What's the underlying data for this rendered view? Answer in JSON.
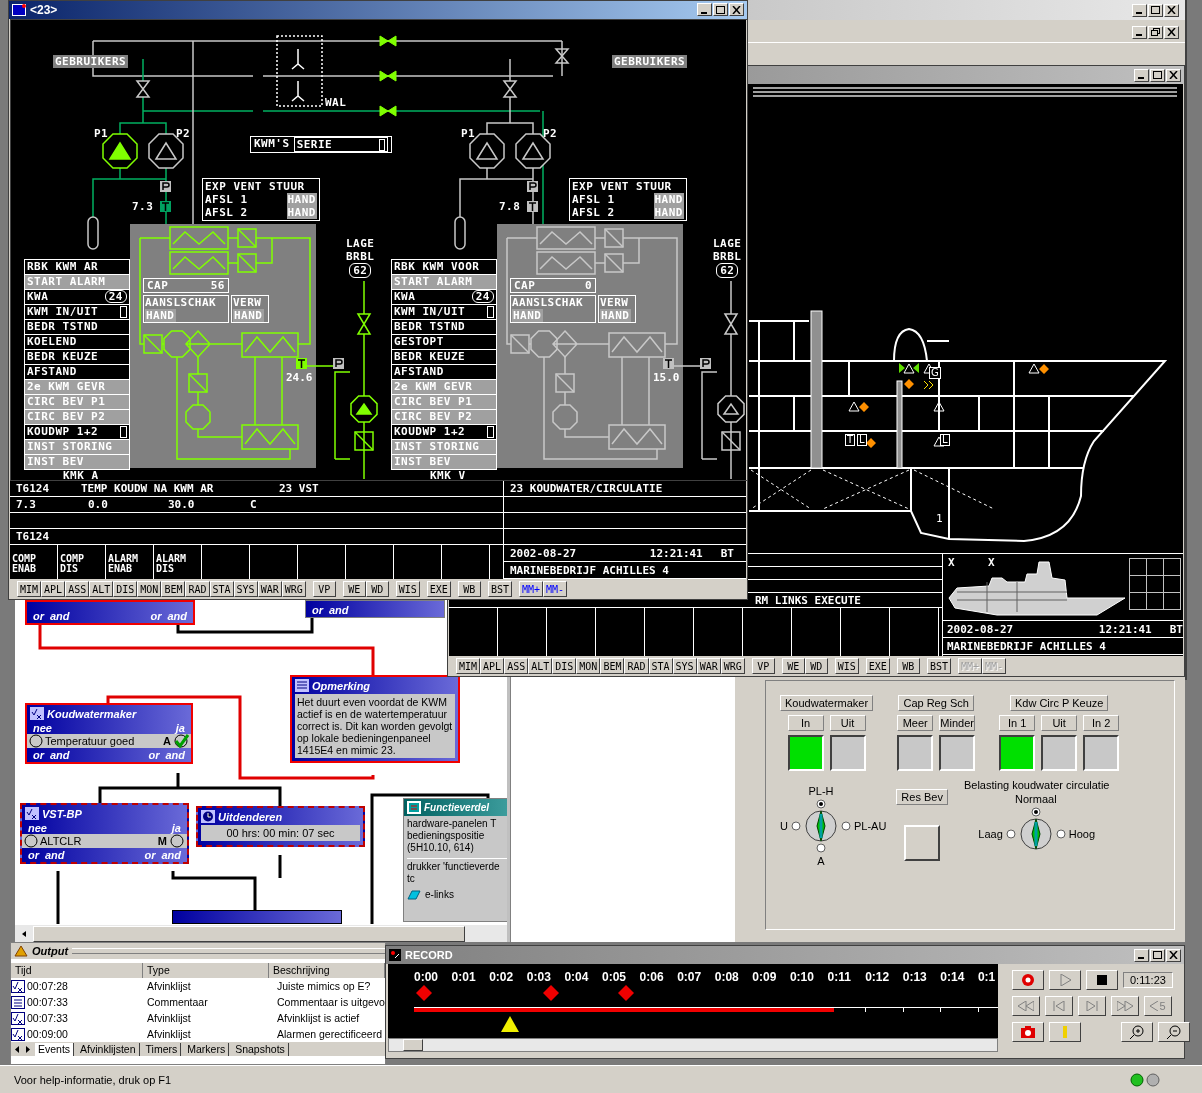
{
  "mimic_window": {
    "title": "<23>",
    "header": {
      "selector_label": "KWM'S",
      "selector_value": "SERIE",
      "shore_label": "WAL"
    },
    "units": [
      {
        "name": "KMK A",
        "active": true,
        "users_label": "GEBRUIKERS",
        "pumps": [
          {
            "label": "P1",
            "running": true
          },
          {
            "label": "P2",
            "running": false
          }
        ],
        "pressure_reading": "7.3",
        "valve_panel": {
          "title": "EXP VENT STUUR",
          "rows": [
            {
              "label": "AFSL 1",
              "value": "HAND"
            },
            {
              "label": "AFSL 2",
              "value": "HAND"
            }
          ]
        },
        "low_level_label": [
          "LAGE",
          "BRBL"
        ],
        "low_level_value": "62",
        "cap": {
          "label": "CAP",
          "value": "56"
        },
        "switch_mode": {
          "label": "AANSLSCHAK",
          "value": "HAND"
        },
        "heating": {
          "label": "VERW",
          "value": "HAND"
        },
        "temp_reading": "24.6",
        "status": [
          {
            "text": "RBK KWM AR",
            "lit": false,
            "kind": "text"
          },
          {
            "text": "START ALARM",
            "lit": true,
            "kind": "text"
          },
          {
            "text": "KWA",
            "lit": false,
            "kind": "badge",
            "badge": "24"
          },
          {
            "text": "KWM IN/UIT",
            "lit": false,
            "kind": "indicator"
          },
          {
            "text": "BEDR TSTND",
            "lit": false,
            "kind": "text"
          },
          {
            "text": "KOELEND",
            "lit": false,
            "kind": "text"
          },
          {
            "text": "BEDR KEUZE",
            "lit": false,
            "kind": "text"
          },
          {
            "text": "AFSTAND",
            "lit": false,
            "kind": "text"
          },
          {
            "text": "2e KWM GEVR",
            "lit": true,
            "kind": "text"
          },
          {
            "text": "CIRC BEV P1",
            "lit": true,
            "kind": "text"
          },
          {
            "text": "CIRC BEV P2",
            "lit": true,
            "kind": "text"
          },
          {
            "text": "KOUDWP 1+2",
            "lit": false,
            "kind": "indicator"
          },
          {
            "text": "INST STORING",
            "lit": true,
            "kind": "text"
          },
          {
            "text": "INST BEV",
            "lit": true,
            "kind": "text"
          }
        ]
      },
      {
        "name": "KMK V",
        "active": false,
        "users_label": "GEBRUIKERS",
        "pumps": [
          {
            "label": "P1",
            "running": false
          },
          {
            "label": "P2",
            "running": false
          }
        ],
        "pressure_reading": "7.8",
        "valve_panel": {
          "title": "EXP VENT STUUR",
          "rows": [
            {
              "label": "AFSL 1",
              "value": "HAND"
            },
            {
              "label": "AFSL 2",
              "value": "HAND"
            }
          ]
        },
        "low_level_label": [
          "LAGE",
          "BRBL"
        ],
        "low_level_value": "62",
        "cap": {
          "label": "CAP",
          "value": "0"
        },
        "switch_mode": {
          "label": "AANSLSCHAK",
          "value": "HAND"
        },
        "heating": {
          "label": "VERW",
          "value": "HAND"
        },
        "temp_reading": "15.0",
        "status": [
          {
            "text": "RBK KWM VOOR",
            "lit": false,
            "kind": "text"
          },
          {
            "text": "START ALARM",
            "lit": true,
            "kind": "text"
          },
          {
            "text": "KWA",
            "lit": false,
            "kind": "badge",
            "badge": "24"
          },
          {
            "text": "KWM IN/UIT",
            "lit": false,
            "kind": "indicator"
          },
          {
            "text": "BEDR TSTND",
            "lit": false,
            "kind": "text"
          },
          {
            "text": "GESTOPT",
            "lit": false,
            "kind": "text"
          },
          {
            "text": "BEDR KEUZE",
            "lit": false,
            "kind": "text"
          },
          {
            "text": "AFSTAND",
            "lit": false,
            "kind": "text"
          },
          {
            "text": "2e KWM GEVR",
            "lit": true,
            "kind": "text"
          },
          {
            "text": "CIRC BEV P1",
            "lit": true,
            "kind": "text"
          },
          {
            "text": "CIRC BEV P2",
            "lit": true,
            "kind": "text"
          },
          {
            "text": "KOUDWP 1+2",
            "lit": false,
            "kind": "indicator"
          },
          {
            "text": "INST STORING",
            "lit": true,
            "kind": "text"
          },
          {
            "text": "INST BEV",
            "lit": true,
            "kind": "text"
          }
        ]
      }
    ],
    "info": {
      "row_1": [
        "T6124",
        "TEMP KOUDW NA KWM AR",
        "23 VST"
      ],
      "row_2": [
        "7.3",
        "0.0",
        "30.0",
        "C"
      ],
      "tag": "T6124",
      "title": "23 KOUDWATER/CIRCULATIE",
      "soft_keys": [
        [
          "COMP",
          "ENAB"
        ],
        [
          "COMP",
          "DIS"
        ],
        [
          "ALARM",
          "ENAB"
        ],
        [
          "ALARM",
          "DIS"
        ]
      ],
      "date": "2002-08-27",
      "time": "12:21:41",
      "zone": "BT",
      "site": "MARINEBEDRIJF ACHILLES 4"
    },
    "nav_keys": [
      {
        "keys": [
          "MIM",
          "APL",
          "ASS",
          "ALT",
          "DIS",
          "MON",
          "BEM",
          "RAD",
          "STA",
          "SYS",
          "WAR",
          "WRG"
        ],
        "kind": "std",
        "disabled": false
      },
      {
        "keys": [
          "VP"
        ],
        "kind": "std",
        "disabled": false
      },
      {
        "keys": [
          "WE",
          "WD"
        ],
        "kind": "std",
        "disabled": false
      },
      {
        "keys": [
          "WIS"
        ],
        "kind": "std",
        "disabled": false
      },
      {
        "keys": [
          "EXE"
        ],
        "kind": "std",
        "disabled": false
      },
      {
        "keys": [
          "WB"
        ],
        "kind": "std",
        "disabled": false
      },
      {
        "keys": [
          "BST"
        ],
        "kind": "std",
        "disabled": false
      },
      {
        "keys": [
          "MM+",
          "MM-"
        ],
        "kind": "mm",
        "disabled": false
      }
    ]
  },
  "ship_window": {
    "compartment_tags": [
      "G",
      "T",
      "L",
      "L"
    ],
    "deck_label": "1",
    "view_marks": [
      "X",
      "X"
    ],
    "message": "RM LINKS EXECUTE",
    "date": "2002-08-27",
    "time": "12:21:41",
    "zone": "BT",
    "site": "MARINEBEDRIJF ACHILLES 4",
    "nav_keys": [
      {
        "keys": [
          "MIM",
          "APL",
          "ASS",
          "ALT",
          "DIS",
          "MON",
          "BEM",
          "RAD",
          "STA",
          "SYS",
          "WAR",
          "WRG"
        ],
        "kind": "std",
        "disabled": false
      },
      {
        "keys": [
          "VP"
        ],
        "kind": "std",
        "disabled": false
      },
      {
        "keys": [
          "WE",
          "WD"
        ],
        "kind": "std",
        "disabled": false
      },
      {
        "keys": [
          "WIS"
        ],
        "kind": "std",
        "disabled": false
      },
      {
        "keys": [
          "EXE"
        ],
        "kind": "std",
        "disabled": false
      },
      {
        "keys": [
          "WB"
        ],
        "kind": "std",
        "disabled": false
      },
      {
        "keys": [
          "BST"
        ],
        "kind": "std",
        "disabled": false
      },
      {
        "keys": [
          "MM+",
          "MM-"
        ],
        "kind": "mm",
        "disabled": true
      }
    ]
  },
  "flow": {
    "blocks": [
      {
        "kind": "partial",
        "highlighted": true,
        "dashed": false,
        "footer": [
          "or",
          "and",
          "or",
          "and"
        ]
      },
      {
        "kind": "partial",
        "highlighted": false,
        "dashed": false,
        "footer": [
          "or",
          "and"
        ]
      },
      {
        "kind": "condition",
        "highlighted": true,
        "dashed": false,
        "title": "Koudwatermaker",
        "no": "nee",
        "yes": "ja",
        "item": "Temperatuur goed",
        "mode": "A",
        "checked": true,
        "footer": [
          "or",
          "and",
          "or",
          "and"
        ]
      },
      {
        "kind": "note",
        "highlighted": true,
        "dashed": false,
        "title": "Opmerking",
        "text": "Het duurt even voordat de KWM actief is en de watertemperatuur correct is. Dit kan worden gevolgt op lokale bedieningenpaneel 1415E4 en mimic 23."
      },
      {
        "kind": "condition",
        "highlighted": true,
        "dashed": true,
        "title": "VST-BP",
        "no": "nee",
        "yes": "ja",
        "item": "ALTCLR",
        "mode": "M",
        "checked": false,
        "footer": [
          "or",
          "and",
          "or",
          "and"
        ]
      },
      {
        "kind": "timer",
        "highlighted": true,
        "dashed": true,
        "title": "Uitdenderen",
        "text": "00 hrs: 00 min: 07 sec"
      },
      {
        "kind": "function",
        "highlighted": false,
        "dashed": false,
        "title": "Functieverdel",
        "lines": [
          "hardware-panelen T",
          "bedieningspositie",
          "(5H10.10, 614)",
          "drukker 'functieverde",
          "tc"
        ],
        "link": "e-links"
      }
    ]
  },
  "control_panel": {
    "groups": [
      {
        "title": "Koudwatermaker",
        "buttons": [
          {
            "label": "In",
            "on": true
          },
          {
            "label": "Uit",
            "on": false
          }
        ]
      },
      {
        "title": "Cap Reg Sch",
        "buttons": [
          {
            "label": "Meer",
            "on": false
          },
          {
            "label": "Minder",
            "on": false
          }
        ]
      },
      {
        "title": "Kdw Circ P Keuze",
        "buttons": [
          {
            "label": "In 1",
            "on": true
          },
          {
            "label": "Uit",
            "on": false
          },
          {
            "label": "In 2",
            "on": false
          }
        ]
      }
    ],
    "knobs": [
      {
        "options": [
          {
            "label": "PL-H",
            "selected": true
          },
          {
            "label": "U",
            "selected": false
          },
          {
            "label": "PL-AU",
            "selected": false
          },
          {
            "label": "A",
            "selected": false
          }
        ]
      },
      {
        "title": "Belasting koudwater circulatie",
        "options": [
          {
            "label": "Normaal",
            "selected": true
          },
          {
            "label": "Laag",
            "selected": false
          },
          {
            "label": "Hoog",
            "selected": false
          }
        ]
      }
    ],
    "reset": {
      "label": "Res Bev",
      "on": false
    }
  },
  "output": {
    "title": "Output",
    "columns": [
      "Tijd",
      "Type",
      "Beschrijving"
    ],
    "rows": [
      {
        "kind": "checklist",
        "time": "00:07:28",
        "type": "Afvinklijst",
        "description": "Juiste mimics op E?"
      },
      {
        "kind": "comment",
        "time": "00:07:33",
        "type": "Commentaar",
        "description": "Commentaar is uitgevo"
      },
      {
        "kind": "checklist",
        "time": "00:07:33",
        "type": "Afvinklijst",
        "description": "Afvinklijst is actief"
      },
      {
        "kind": "checklist",
        "time": "00:09:00",
        "type": "Afvinklijst",
        "description": "Alarmen gerectificeerd"
      }
    ],
    "tabs": [
      {
        "label": "Events",
        "selected": true
      },
      {
        "label": "Afvinklijsten",
        "selected": false
      },
      {
        "label": "Timers",
        "selected": false
      },
      {
        "label": "Markers",
        "selected": false
      },
      {
        "label": "Snapshots",
        "selected": false
      }
    ]
  },
  "record": {
    "title": "RECORD",
    "ticks": [
      "0:00",
      "0:01",
      "0:02",
      "0:03",
      "0:04",
      "0:05",
      "0:06",
      "0:07",
      "0:08",
      "0:09",
      "0:10",
      "0:11",
      "0:12",
      "0:13",
      "0:14",
      "0:1"
    ],
    "level": 0.72,
    "elapsed": "0:11:23",
    "step_label": "5"
  },
  "status_bar": {
    "text": "Voor help-informatie, druk op F1"
  }
}
